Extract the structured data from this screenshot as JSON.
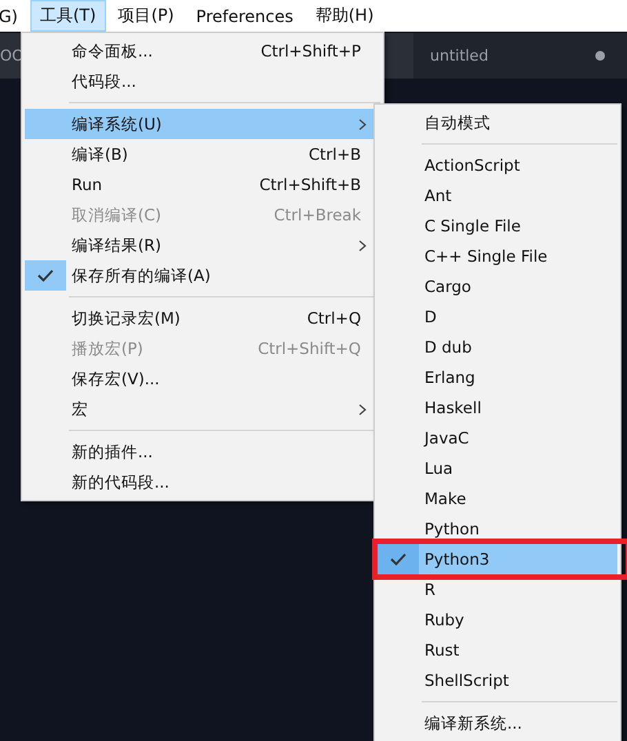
{
  "menu_bar": [
    {
      "label": "G)",
      "selected": false
    },
    {
      "label": "工具(T)",
      "selected": true
    },
    {
      "label": "项目(P)",
      "selected": false
    },
    {
      "label": "Preferences",
      "selected": false
    },
    {
      "label": "帮助(H)",
      "selected": false
    }
  ],
  "tabs": [
    {
      "label": "OO",
      "selected": false
    },
    {
      "label": "untitled",
      "selected": false
    }
  ],
  "tools_menu": [
    {
      "kind": "item",
      "label": "命令面板...",
      "shortcut": "Ctrl+Shift+P",
      "selected": false,
      "disabled": false,
      "checked": false,
      "submenu": false
    },
    {
      "kind": "item",
      "label": "代码段...",
      "selected": false,
      "disabled": false,
      "checked": false,
      "submenu": false
    },
    {
      "kind": "separator"
    },
    {
      "kind": "item",
      "label": "编译系统(U)",
      "selected": true,
      "disabled": false,
      "checked": false,
      "submenu": true
    },
    {
      "kind": "item",
      "label": "编译(B)",
      "shortcut": "Ctrl+B",
      "selected": false,
      "disabled": false,
      "checked": false,
      "submenu": false
    },
    {
      "kind": "item",
      "label": "Run",
      "shortcut": "Ctrl+Shift+B",
      "selected": false,
      "disabled": false,
      "checked": false,
      "submenu": false
    },
    {
      "kind": "item",
      "label": "取消编译(C)",
      "shortcut": "Ctrl+Break",
      "selected": false,
      "disabled": true,
      "checked": false,
      "submenu": false
    },
    {
      "kind": "item",
      "label": "编译结果(R)",
      "selected": false,
      "disabled": false,
      "checked": false,
      "submenu": true
    },
    {
      "kind": "item",
      "label": "保存所有的编译(A)",
      "selected": false,
      "disabled": false,
      "checked": true,
      "submenu": false
    },
    {
      "kind": "separator"
    },
    {
      "kind": "item",
      "label": "切换记录宏(M)",
      "shortcut": "Ctrl+Q",
      "selected": false,
      "disabled": false,
      "checked": false,
      "submenu": false
    },
    {
      "kind": "item",
      "label": "播放宏(P)",
      "shortcut": "Ctrl+Shift+Q",
      "selected": false,
      "disabled": true,
      "checked": false,
      "submenu": false
    },
    {
      "kind": "item",
      "label": "保存宏(V)...",
      "selected": false,
      "disabled": false,
      "checked": false,
      "submenu": false
    },
    {
      "kind": "item",
      "label": "宏",
      "selected": false,
      "disabled": false,
      "checked": false,
      "submenu": true
    },
    {
      "kind": "separator"
    },
    {
      "kind": "item",
      "label": "新的插件...",
      "selected": false,
      "disabled": false,
      "checked": false,
      "submenu": false
    },
    {
      "kind": "item",
      "label": "新的代码段...",
      "selected": false,
      "disabled": false,
      "checked": false,
      "submenu": false
    }
  ],
  "build_system_menu": [
    {
      "kind": "item",
      "label": "自动模式",
      "selected": false,
      "checked": false
    },
    {
      "kind": "separator"
    },
    {
      "kind": "item",
      "label": "ActionScript",
      "selected": false,
      "checked": false
    },
    {
      "kind": "item",
      "label": "Ant",
      "selected": false,
      "checked": false
    },
    {
      "kind": "item",
      "label": "C Single File",
      "selected": false,
      "checked": false
    },
    {
      "kind": "item",
      "label": "C++ Single File",
      "selected": false,
      "checked": false
    },
    {
      "kind": "item",
      "label": "Cargo",
      "selected": false,
      "checked": false
    },
    {
      "kind": "item",
      "label": "D",
      "selected": false,
      "checked": false
    },
    {
      "kind": "item",
      "label": "D dub",
      "selected": false,
      "checked": false
    },
    {
      "kind": "item",
      "label": "Erlang",
      "selected": false,
      "checked": false
    },
    {
      "kind": "item",
      "label": "Haskell",
      "selected": false,
      "checked": false
    },
    {
      "kind": "item",
      "label": "JavaC",
      "selected": false,
      "checked": false
    },
    {
      "kind": "item",
      "label": "Lua",
      "selected": false,
      "checked": false
    },
    {
      "kind": "item",
      "label": "Make",
      "selected": false,
      "checked": false
    },
    {
      "kind": "item",
      "label": "Python",
      "selected": false,
      "checked": false
    },
    {
      "kind": "item",
      "label": "Python3",
      "selected": true,
      "checked": true,
      "annotated": true
    },
    {
      "kind": "item",
      "label": "R",
      "selected": false,
      "checked": false
    },
    {
      "kind": "item",
      "label": "Ruby",
      "selected": false,
      "checked": false
    },
    {
      "kind": "item",
      "label": "Rust",
      "selected": false,
      "checked": false
    },
    {
      "kind": "item",
      "label": "ShellScript",
      "selected": false,
      "checked": false
    },
    {
      "kind": "separator"
    },
    {
      "kind": "item",
      "label": "编译新系统...",
      "selected": false,
      "checked": false
    }
  ]
}
